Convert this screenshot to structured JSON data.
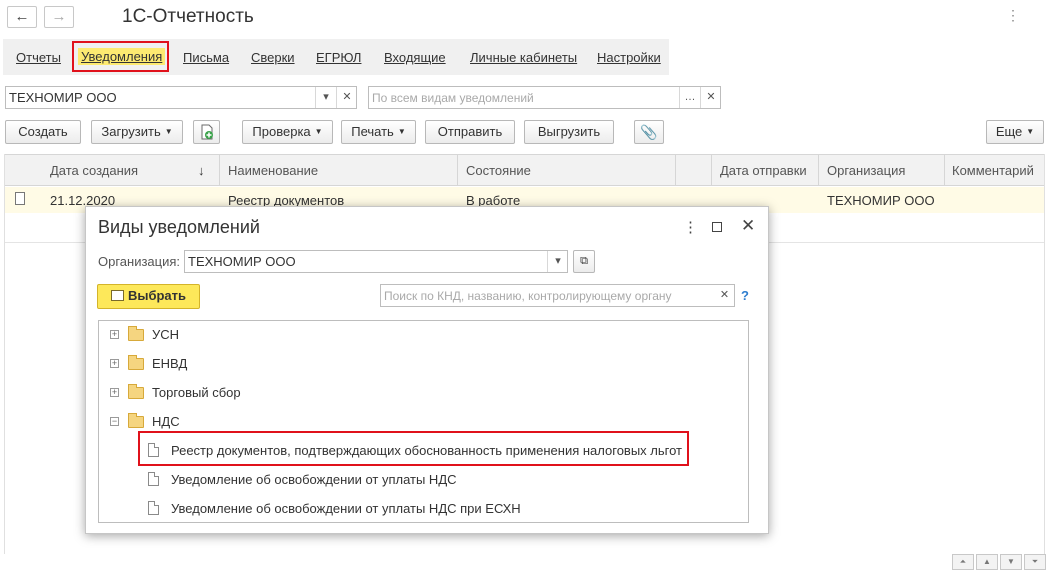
{
  "window": {
    "title": "1С-Отчетность",
    "back_icon": "←",
    "forward_icon": "→",
    "more_icon": "⋮"
  },
  "tabs": [
    "Отчеты",
    "Уведомления",
    "Письма",
    "Сверки",
    "ЕГРЮЛ",
    "Входящие",
    "Личные кабинеты",
    "Настройки"
  ],
  "filters": {
    "organization": "ТЕХНОМИР ООО",
    "kind_placeholder": "По всем видам уведомлений"
  },
  "toolbar": {
    "create": "Создать",
    "load": "Загрузить",
    "check": "Проверка",
    "print": "Печать",
    "send": "Отправить",
    "export": "Выгрузить",
    "more": "Еще"
  },
  "table": {
    "headers": {
      "date": "Дата создания",
      "sort_arrow": "↓",
      "name": "Наименование",
      "state": "Состояние",
      "send_date": "Дата отправки",
      "org": "Организация",
      "comment": "Комментарий"
    },
    "rows": [
      {
        "date": "21.12.2020",
        "name": "Реестр документов",
        "state": "В работе",
        "org": "ТЕХНОМИР ООО"
      }
    ]
  },
  "dialog": {
    "title": "Виды уведомлений",
    "org_label": "Организация:",
    "org_value": "ТЕХНОМИР ООО",
    "select_button": "Выбрать",
    "search_placeholder": "Поиск по КНД, названию, контролирующему органу",
    "help": "?",
    "tree": [
      {
        "label": "УСН",
        "type": "folder",
        "expanded": false
      },
      {
        "label": "ЕНВД",
        "type": "folder",
        "expanded": false
      },
      {
        "label": "Торговый сбор",
        "type": "folder",
        "expanded": false
      },
      {
        "label": "НДС",
        "type": "folder",
        "expanded": true
      },
      {
        "label": "Реестр документов, подтверждающих обоснованность применения налоговых льгот",
        "type": "doc"
      },
      {
        "label": "Уведомление об освобождении от уплаты НДС",
        "type": "doc"
      },
      {
        "label": "Уведомление об освобождении от уплаты НДС при ЕСХН",
        "type": "doc"
      }
    ]
  },
  "colors": {
    "highlight": "#e0111b",
    "active_tab": "#fdea71",
    "select_button": "#fde85a"
  }
}
